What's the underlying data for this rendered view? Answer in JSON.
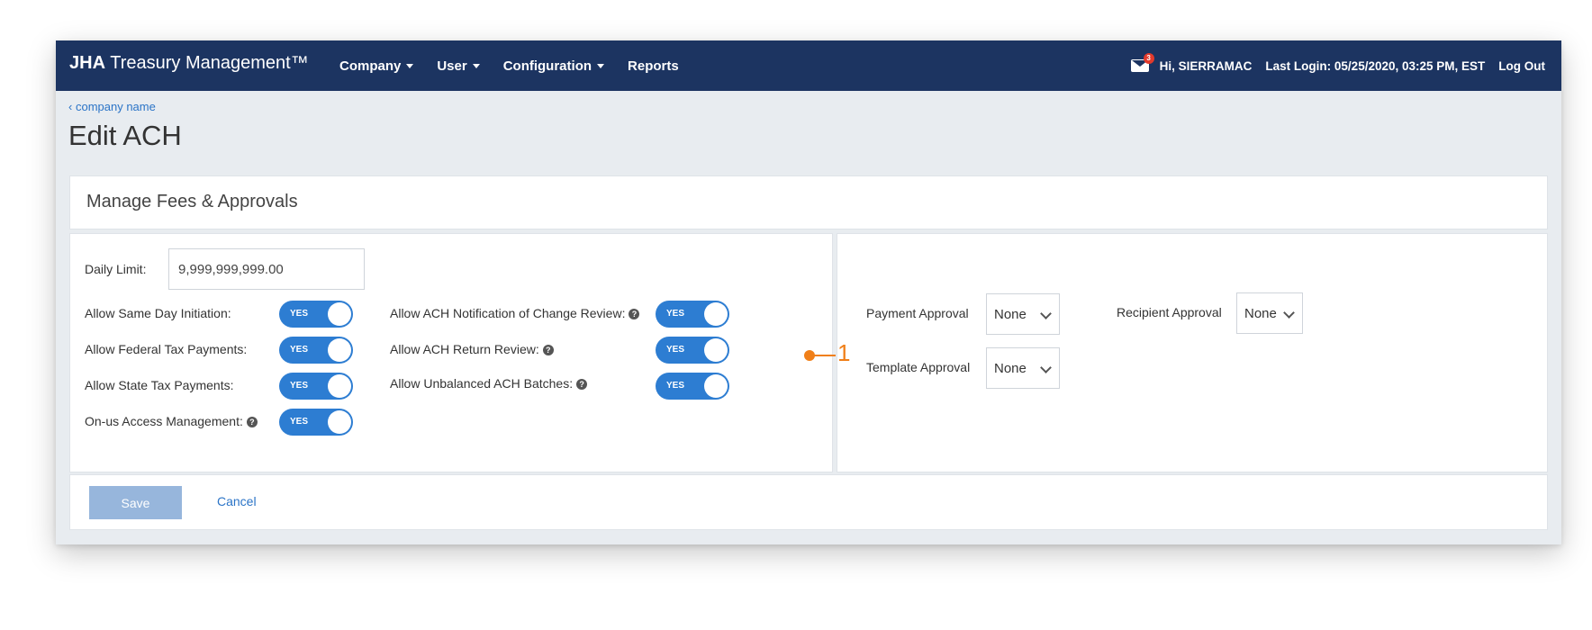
{
  "navbar": {
    "brand_bold": "JHA",
    "brand_rest": "Treasury Management™",
    "menu": [
      {
        "label": "Company",
        "has_caret": true
      },
      {
        "label": "User",
        "has_caret": true
      },
      {
        "label": "Configuration",
        "has_caret": true
      },
      {
        "label": "Reports",
        "has_caret": false
      }
    ],
    "mail_badge": "3",
    "greeting": "Hi, SIERRAMAC",
    "last_login": "Last Login: 05/25/2020, 03:25 PM, EST",
    "logout": "Log Out"
  },
  "breadcrumb": "company name",
  "page_title": "Edit ACH",
  "section_title": "Manage Fees & Approvals",
  "left": {
    "daily_limit_label": "Daily Limit:",
    "daily_limit_value": "9,999,999,999.00",
    "col1": [
      {
        "label": "Allow Same Day Initiation:",
        "value": "YES",
        "help": false
      },
      {
        "label": "Allow Federal Tax Payments:",
        "value": "YES",
        "help": false
      },
      {
        "label": "Allow State Tax Payments:",
        "value": "YES",
        "help": false
      },
      {
        "label": "On-us Access Management:",
        "value": "YES",
        "help": true
      }
    ],
    "col2": [
      {
        "label": "Allow ACH Notification of Change Review:",
        "value": "YES",
        "help": true
      },
      {
        "label": "Allow ACH Return Review:",
        "value": "YES",
        "help": true
      },
      {
        "label": "Allow Unbalanced ACH Batches:",
        "value": "YES",
        "help": true
      }
    ]
  },
  "right": {
    "payment_approval_label": "Payment Approval",
    "payment_approval_value": "None",
    "recipient_approval_label": "Recipient Approval",
    "recipient_approval_value": "None",
    "template_approval_label": "Template Approval",
    "template_approval_value": "None"
  },
  "footer": {
    "save": "Save",
    "cancel": "Cancel"
  },
  "callout": {
    "number": "1",
    "color": "#f07f18"
  },
  "colors": {
    "navbar": "#1c3461",
    "toggle_on": "#2d7dd2",
    "link": "#2b74c7",
    "save_disabled": "#97b6dc"
  }
}
